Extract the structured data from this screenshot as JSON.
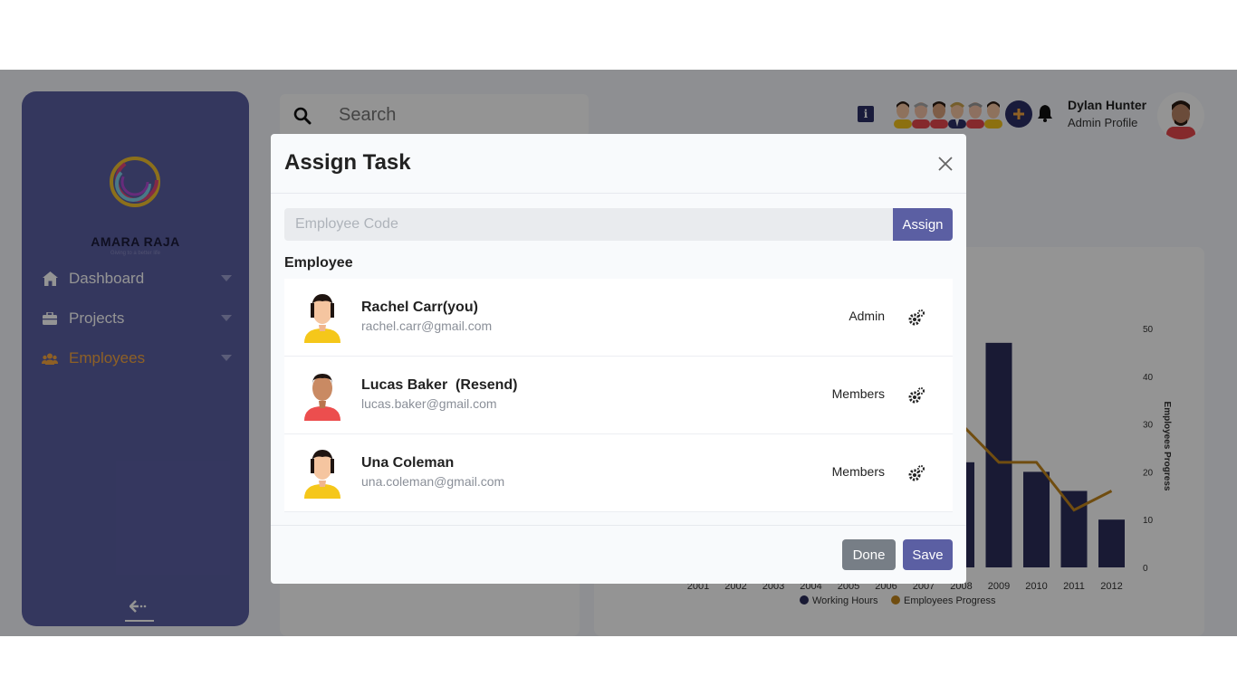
{
  "brand": {
    "name": "AMARA RAJA",
    "tagline": "Giving to a better life"
  },
  "sidebar": {
    "items": [
      {
        "label": "Dashboard",
        "icon": "home-icon"
      },
      {
        "label": "Projects",
        "icon": "briefcase-icon"
      },
      {
        "label": "Employees",
        "icon": "users-icon",
        "active": true
      }
    ],
    "collapse_icon": "arrow-left-icon"
  },
  "search": {
    "placeholder": "Search"
  },
  "header": {
    "info_label": "i",
    "user_name": "Dylan Hunter",
    "user_role": "Admin Profile"
  },
  "chart_data": {
    "type": "bar",
    "categories": [
      "2001",
      "2002",
      "2003",
      "2004",
      "2005",
      "2006",
      "2007",
      "2008",
      "2009",
      "2010",
      "2011",
      "2012"
    ],
    "visible_categories_from_index": 7,
    "series": [
      {
        "name": "Working Hours",
        "type": "bar",
        "color": "#2c2d5b",
        "values": [
          null,
          null,
          null,
          null,
          null,
          null,
          null,
          22,
          47,
          20,
          16,
          10
        ]
      },
      {
        "name": "Employees Progress",
        "type": "line",
        "color": "#c2861d",
        "values": [
          null,
          null,
          null,
          null,
          null,
          null,
          null,
          30,
          22,
          22,
          12,
          16
        ]
      }
    ],
    "y2label": "Employees Progress",
    "y2ticks": [
      "0",
      "10",
      "20",
      "30",
      "40",
      "50"
    ],
    "ylim": [
      0,
      50
    ],
    "legend": "bottom"
  },
  "modal": {
    "title": "Assign Task",
    "code_placeholder": "Employee Code",
    "assign_label": "Assign",
    "section_label": "Employee",
    "employees": [
      {
        "name": "Rachel Carr(you)",
        "email": "rachel.carr@gmail.com",
        "role": "Admin"
      },
      {
        "name": "Lucas Baker  (Resend)",
        "email": "lucas.baker@gmail.com",
        "role": "Members"
      },
      {
        "name": "Una Coleman",
        "email": "una.coleman@gmail.com",
        "role": "Members"
      }
    ],
    "done_label": "Done",
    "save_label": "Save"
  },
  "colors": {
    "accent": "#5b5fa3",
    "active_nav": "#f4a640",
    "bar": "#2c2d5b",
    "line": "#c2861d"
  }
}
